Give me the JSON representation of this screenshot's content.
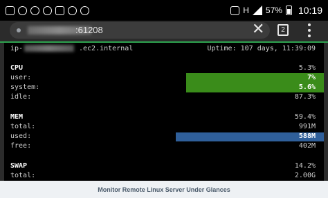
{
  "status_bar": {
    "battery_percent": "57%",
    "time": "10:19",
    "network": "H"
  },
  "browser": {
    "url_suffix": ":61208",
    "tab_count": "2",
    "accent_color": "#2ea44f"
  },
  "glances": {
    "host_prefix": "ip-",
    "host_suffix": ".ec2.internal",
    "uptime": "Uptime: 107 days, 11:39:09",
    "cpu": {
      "title": "CPU",
      "total": "5.3%",
      "rows": [
        {
          "label": "user:",
          "value": "7%",
          "bar_fraction": 0.36
        },
        {
          "label": "system:",
          "value": "5.6%",
          "bar_fraction": 0.36
        },
        {
          "label": "idle:",
          "value": "87.3%"
        }
      ]
    },
    "mem": {
      "title": "MEM",
      "total": "59.4%",
      "rows": [
        {
          "label": "total:",
          "value": "991M"
        },
        {
          "label": "used:",
          "value": "588M",
          "bar_fraction": 0.45
        },
        {
          "label": "free:",
          "value": "402M"
        }
      ]
    },
    "swap": {
      "title": "SWAP",
      "total": "14.2%",
      "rows": [
        {
          "label": "total:",
          "value": "2.00G"
        }
      ]
    },
    "colors": {
      "cpu_bar": "#3a8c1a",
      "mem_bar": "#2f5f9a"
    }
  },
  "footer": {
    "caption": "Monitor Remote Linux Server Under Glances"
  }
}
